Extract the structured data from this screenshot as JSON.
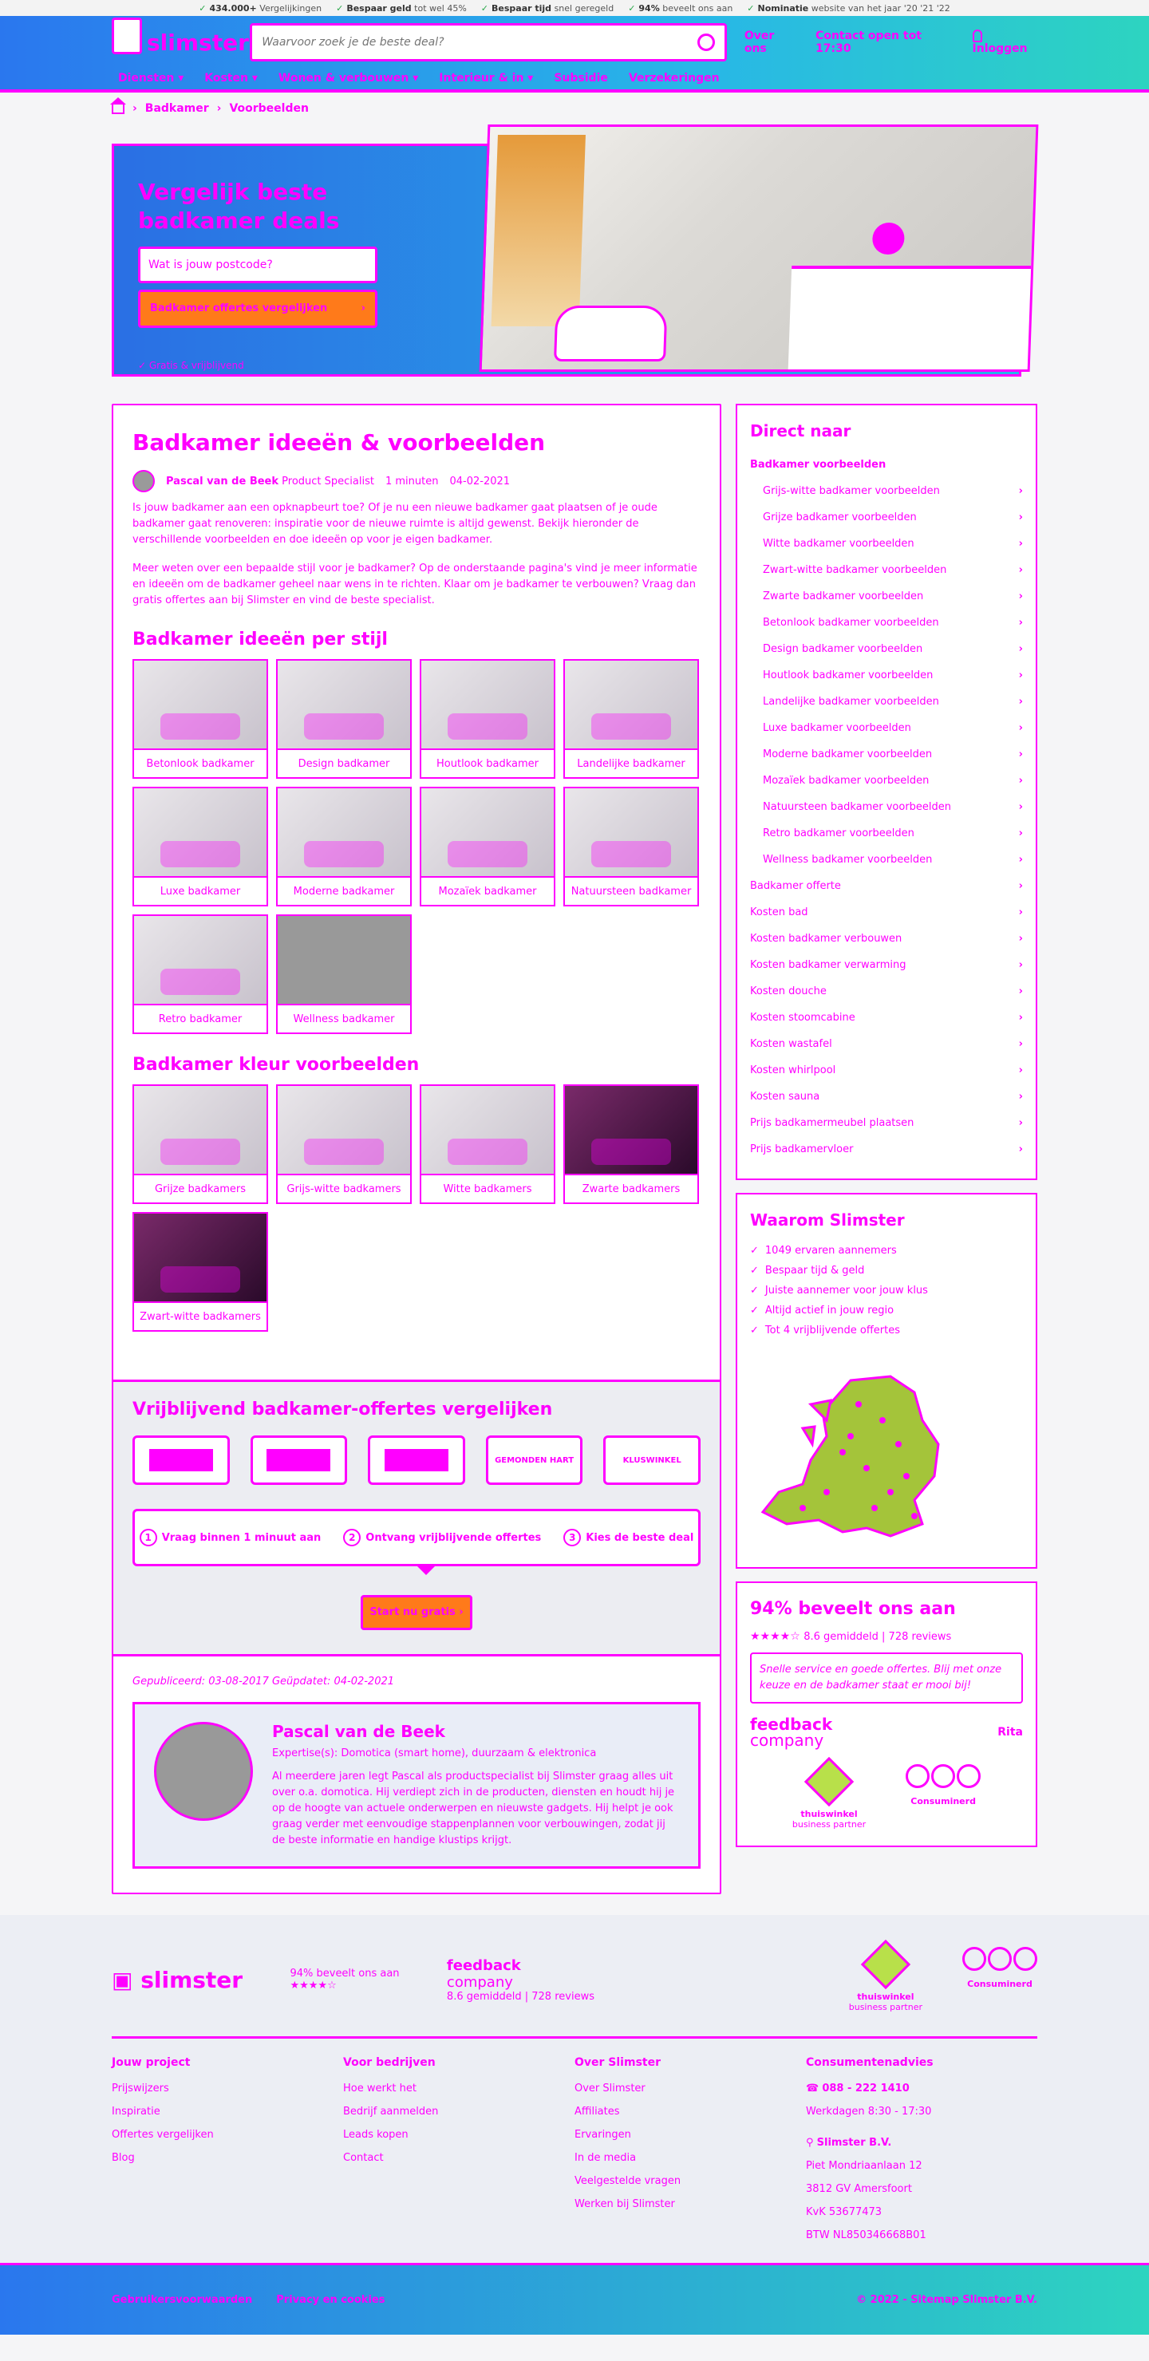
{
  "topstrip": [
    {
      "b": "434.000+",
      "t": "Vergelijkingen"
    },
    {
      "b": "Bespaar geld",
      "t": "tot wel 45%"
    },
    {
      "b": "Bespaar tijd",
      "t": "snel geregeld"
    },
    {
      "b": "94%",
      "t": "beveelt ons aan"
    },
    {
      "b": "Nominatie",
      "t": "website van het jaar '20 '21 '22"
    }
  ],
  "header": {
    "logo": "slimster",
    "search_placeholder": "Waarvoor zoek je de beste deal?",
    "links": [
      "Over ons",
      "Contact open tot 17:30",
      "Inloggen"
    ],
    "nav": [
      "Diensten ▾",
      "Kosten ▾",
      "Wonen & verbouwen ▾",
      "Interieur & in ▾",
      "Subsidie",
      "Verzekeringen"
    ]
  },
  "breadcrumb": [
    "Badkamer",
    "Voorbeelden"
  ],
  "hero": {
    "title": "Vergelijk beste badkamer deals",
    "postcode_placeholder": "Wat is jouw postcode?",
    "cta": "Badkamer offertes vergelijken",
    "free": "Gratis & vrijblijvend"
  },
  "article": {
    "title": "Badkamer ideeën & voorbeelden",
    "author": "Pascal van de Beek",
    "role": "Product Specialist",
    "read": "1 minuten",
    "date": "04-02-2021",
    "p1": "Is jouw badkamer aan een opknapbeurt toe? Of je nu een nieuwe badkamer gaat plaatsen of je oude badkamer gaat renoveren: inspiratie voor de nieuwe ruimte is altijd gewenst. Bekijk hieronder de verschillende voorbeelden en doe ideeën op voor je eigen badkamer.",
    "p2": "Meer weten over een bepaalde stijl voor je badkamer? Op de onderstaande pagina's vind je meer informatie en ideeën om de badkamer geheel naar wens in te richten. Klaar om je badkamer te verbouwen? Vraag dan gratis offertes aan bij Slimster en vind de beste specialist.",
    "sec1": "Badkamer ideeën per stijl",
    "styles": [
      "Betonlook badkamer",
      "Design badkamer",
      "Houtlook badkamer",
      "Landelijke badkamer",
      "Luxe badkamer",
      "Moderne badkamer",
      "Mozaïek badkamer",
      "Natuursteen badkamer",
      "Retro badkamer",
      "Wellness badkamer"
    ],
    "sec2": "Badkamer kleur voorbeelden",
    "colors": [
      "Grijze badkamers",
      "Grijs-witte badkamers",
      "Witte badkamers",
      "Zwarte badkamers",
      "Zwart-witte badkamers"
    ]
  },
  "offers": {
    "title": "Vrijblijvend badkamer-offertes vergelijken",
    "partners": [
      "",
      "",
      "",
      "GEMONDEN HART",
      "KLUSWINKEL"
    ],
    "steps": [
      {
        "n": "1",
        "t": "Vraag binnen 1 minuut aan"
      },
      {
        "n": "2",
        "t": "Ontvang vrijblijvende offertes"
      },
      {
        "n": "3",
        "t": "Kies de beste deal"
      }
    ],
    "start": "Start nu gratis ›"
  },
  "pub": {
    "dates": "Gepubliceerd: 03-08-2017   Geüpdatet: 04-02-2021",
    "name": "Pascal van de Beek",
    "expertise": "Expertise(s): Domotica (smart home), duurzaam & elektronica",
    "bio": "Al meerdere jaren legt Pascal als productspecialist bij Slimster graag alles uit over o.a. domotica. Hij verdiept zich in de producten, diensten en houdt hij je op de hoogte van actuele onderwerpen en nieuwste gadgets. Hij helpt je ook graag verder met eenvoudige stappenplannen voor verbouwingen, zodat jij de beste informatie en handige klustips krijgt."
  },
  "side": {
    "direct": "Direct naar",
    "main": "Badkamer voorbeelden",
    "subs": [
      "Grijs-witte badkamer voorbeelden",
      "Grijze badkamer voorbeelden",
      "Witte badkamer voorbeelden",
      "Zwart-witte badkamer voorbeelden",
      "Zwarte badkamer voorbeelden",
      "Betonlook badkamer voorbeelden",
      "Design badkamer voorbeelden",
      "Houtlook badkamer voorbeelden",
      "Landelijke badkamer voorbeelden",
      "Luxe badkamer voorbeelden",
      "Moderne badkamer voorbeelden",
      "Mozaïek badkamer voorbeelden",
      "Natuursteen badkamer voorbeelden",
      "Retro badkamer voorbeelden",
      "Wellness badkamer voorbeelden"
    ],
    "others": [
      "Badkamer offerte",
      "Kosten bad",
      "Kosten badkamer verbouwen",
      "Kosten badkamer verwarming",
      "Kosten douche",
      "Kosten stoomcabine",
      "Kosten wastafel",
      "Kosten whirlpool",
      "Kosten sauna",
      "Prijs badkamermeubel plaatsen",
      "Prijs badkamervloer"
    ],
    "why_title": "Waarom Slimster",
    "why": [
      "1049 ervaren aannemers",
      "Bespaar tijd & geld",
      "Juiste aannemer voor jouw klus",
      "Altijd actief in jouw regio",
      "Tot 4 vrijblijvende offertes"
    ],
    "score_title": "94% beveelt ons aan",
    "score_sub": "8.6 gemiddeld  |  728 reviews",
    "quote": "Snelle service en goede offertes. Blij met onze keuze en de badkamer staat er mooi bij!",
    "fb1": "feedback",
    "fb2": "company",
    "reviewer": "Rita",
    "badge1": "thuiswinkel",
    "badge1b": "business partner",
    "badge2": "Consuminerd"
  },
  "footer": {
    "logo": "slimster",
    "score": "94% beveelt ons aan",
    "fb1": "feedback",
    "fb2": "company",
    "fb_sub": "8.6 gemiddeld  |  728 reviews",
    "badge1": "thuiswinkel",
    "badge1b": "business partner",
    "badge2": "Consuminerd",
    "col1_title": "Jouw project",
    "col1": [
      "Prijswijzers",
      "Inspiratie",
      "Offertes vergelijken",
      "Blog"
    ],
    "col2_title": "Voor bedrijven",
    "col2": [
      "Hoe werkt het",
      "Bedrijf aanmelden",
      "Leads kopen",
      "Contact"
    ],
    "col3_title": "Over Slimster",
    "col3": [
      "Over Slimster",
      "Affiliates",
      "Ervaringen",
      "In de media",
      "Veelgestelde vragen",
      "Werken bij Slimster"
    ],
    "col4_title": "Consumentenadvies",
    "phone": "088 - 222 1410",
    "hours": "Werkdagen 8:30 - 17:30",
    "company": "Slimster B.V.",
    "address": [
      "Piet Mondriaanlaan 12",
      "3812 GV Amersfoort",
      "KvK 53677473",
      "BTW NL850346668B01"
    ],
    "bottom_left": [
      "Gebruikersvoorwaarden",
      "Privacy en cookies"
    ],
    "bottom_right": "© 2022 - Sitemap  Slimster B.V."
  }
}
